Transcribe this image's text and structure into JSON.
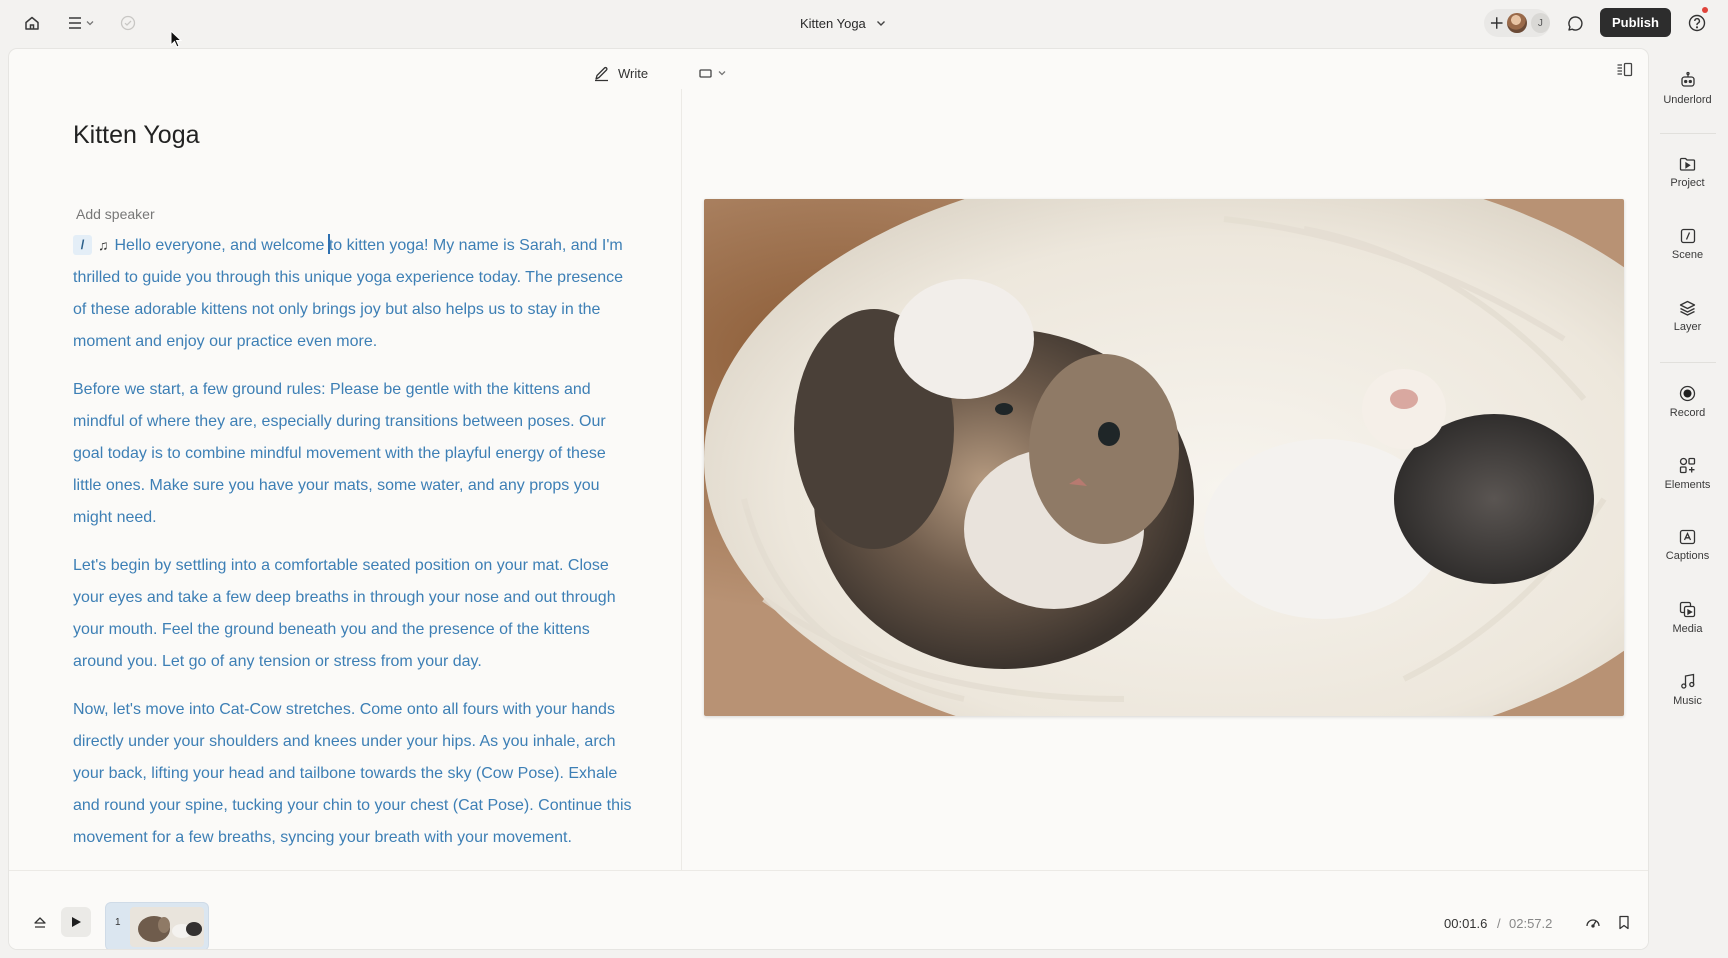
{
  "topbar": {
    "project_title": "Kitten Yoga",
    "publish_label": "Publish",
    "avatar_initial": "J"
  },
  "editor": {
    "write_label": "Write",
    "doc_title": "Kitten Yoga",
    "add_speaker": "Add speaker",
    "slash_chip": "/",
    "paragraphs": [
      {
        "before_cursor": "Hello everyone, and welcome ",
        "after_cursor": "to kitten yoga! My name is Sarah, and I'm thrilled to guide you through this unique yoga experience today. The presence of these adorable kittens not only brings joy but also helps us to stay in the moment and enjoy our practice even more."
      },
      {
        "text": "Before we start, a few ground rules: Please be gentle with the kittens and mindful of where they are, especially during transitions between poses. Our goal today is to combine mindful movement with the playful energy of these little ones. Make sure you have your mats, some water, and any props you might need."
      },
      {
        "text": "Let's begin by settling into a comfortable seated position on your mat. Close your eyes and take a few deep breaths in through your nose and out through your mouth. Feel the ground beneath you and the presence of the kittens around you. Let go of any tension or stress from your day."
      },
      {
        "text": "Now, let's move into Cat-Cow stretches. Come onto all fours with your hands directly under your shoulders and knees under your hips. As you inhale, arch your back, lifting your head and tailbone towards the sky (Cow Pose). Exhale and round your spine, tucking your chin to your chest (Cat Pose). Continue this movement for a few breaths, syncing your breath with your movement."
      }
    ]
  },
  "timeline": {
    "scene_number": "1",
    "current_time": "00:01.6",
    "separator": "/",
    "total_time": "02:57.2"
  },
  "sidebar": {
    "items": [
      {
        "label": "Underlord",
        "icon": "robot-icon"
      },
      {
        "label": "Project",
        "icon": "folder-play-icon"
      },
      {
        "label": "Scene",
        "icon": "scene-slash-icon"
      },
      {
        "label": "Layer",
        "icon": "layers-icon"
      },
      {
        "label": "Record",
        "icon": "record-icon"
      },
      {
        "label": "Elements",
        "icon": "elements-icon"
      },
      {
        "label": "Captions",
        "icon": "captions-icon"
      },
      {
        "label": "Media",
        "icon": "media-icon"
      },
      {
        "label": "Music",
        "icon": "music-note-icon"
      }
    ]
  },
  "colors": {
    "script_text": "#3d7fb5",
    "publish_bg": "#2d2d2d",
    "notification": "#e0433a"
  }
}
